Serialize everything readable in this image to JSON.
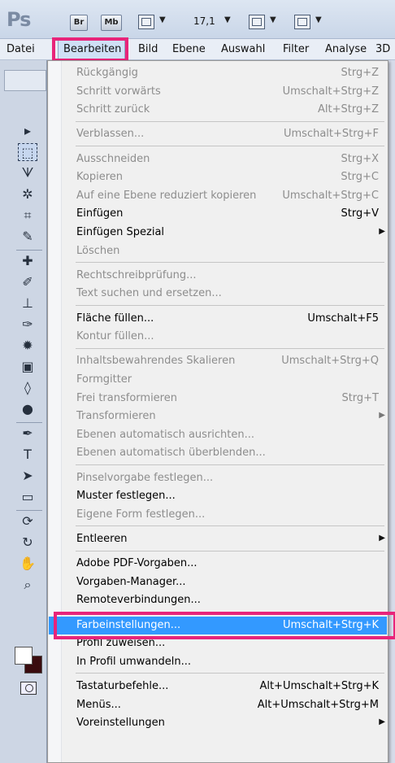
{
  "app": {
    "logo": "Ps",
    "bridge_label": "Br",
    "minibridge_label": "Mb",
    "zoom": "17,1"
  },
  "menubar": [
    "Datei",
    "Bearbeiten",
    "Bild",
    "Ebene",
    "Auswahl",
    "Filter",
    "Analyse",
    "3D"
  ],
  "highlight_color": "#e8247a",
  "selection_color": "#3399ff",
  "menu_groups": [
    [
      {
        "label": "Rückgängig",
        "shortcut": "Strg+Z",
        "enabled": false
      },
      {
        "label": "Schritt vorwärts",
        "shortcut": "Umschalt+Strg+Z",
        "enabled": false
      },
      {
        "label": "Schritt zurück",
        "shortcut": "Alt+Strg+Z",
        "enabled": false
      }
    ],
    [
      {
        "label": "Verblassen...",
        "shortcut": "Umschalt+Strg+F",
        "enabled": false
      }
    ],
    [
      {
        "label": "Ausschneiden",
        "shortcut": "Strg+X",
        "enabled": false
      },
      {
        "label": "Kopieren",
        "shortcut": "Strg+C",
        "enabled": false
      },
      {
        "label": "Auf eine Ebene reduziert kopieren",
        "shortcut": "Umschalt+Strg+C",
        "enabled": false
      },
      {
        "label": "Einfügen",
        "shortcut": "Strg+V",
        "enabled": true
      },
      {
        "label": "Einfügen Spezial",
        "shortcut": "",
        "enabled": true,
        "submenu": true
      },
      {
        "label": "Löschen",
        "shortcut": "",
        "enabled": false
      }
    ],
    [
      {
        "label": "Rechtschreibprüfung...",
        "shortcut": "",
        "enabled": false
      },
      {
        "label": "Text suchen und ersetzen...",
        "shortcut": "",
        "enabled": false
      }
    ],
    [
      {
        "label": "Fläche füllen...",
        "shortcut": "Umschalt+F5",
        "enabled": true
      },
      {
        "label": "Kontur füllen...",
        "shortcut": "",
        "enabled": false
      }
    ],
    [
      {
        "label": "Inhaltsbewahrendes Skalieren",
        "shortcut": "Umschalt+Strg+Q",
        "enabled": false
      },
      {
        "label": "Formgitter",
        "shortcut": "",
        "enabled": false
      },
      {
        "label": "Frei transformieren",
        "shortcut": "Strg+T",
        "enabled": false
      },
      {
        "label": "Transformieren",
        "shortcut": "",
        "enabled": false,
        "submenu": true
      },
      {
        "label": "Ebenen automatisch ausrichten...",
        "shortcut": "",
        "enabled": false
      },
      {
        "label": "Ebenen automatisch überblenden...",
        "shortcut": "",
        "enabled": false
      }
    ],
    [
      {
        "label": "Pinselvorgabe festlegen...",
        "shortcut": "",
        "enabled": false
      },
      {
        "label": "Muster festlegen...",
        "shortcut": "",
        "enabled": true
      },
      {
        "label": "Eigene Form festlegen...",
        "shortcut": "",
        "enabled": false
      }
    ],
    [
      {
        "label": "Entleeren",
        "shortcut": "",
        "enabled": true,
        "submenu": true
      }
    ],
    [
      {
        "label": "Adobe PDF-Vorgaben...",
        "shortcut": "",
        "enabled": true
      },
      {
        "label": "Vorgaben-Manager...",
        "shortcut": "",
        "enabled": true
      },
      {
        "label": "Remoteverbindungen...",
        "shortcut": "",
        "enabled": true
      }
    ],
    [
      {
        "label": "Farbeinstellungen...",
        "shortcut": "Umschalt+Strg+K",
        "enabled": true,
        "selected": true
      },
      {
        "label": "Profil zuweisen...",
        "shortcut": "",
        "enabled": true
      },
      {
        "label": "In Profil umwandeln...",
        "shortcut": "",
        "enabled": true
      }
    ],
    [
      {
        "label": "Tastaturbefehle...",
        "shortcut": "Alt+Umschalt+Strg+K",
        "enabled": true
      },
      {
        "label": "Menüs...",
        "shortcut": "Alt+Umschalt+Strg+M",
        "enabled": true
      },
      {
        "label": "Voreinstellungen",
        "shortcut": "",
        "enabled": true,
        "submenu": true
      }
    ]
  ],
  "tools": [
    {
      "icon": "move-tool-icon",
      "glyph": "▸"
    },
    {
      "icon": "marquee-tool-icon",
      "glyph": "⬚",
      "selected": true
    },
    {
      "icon": "lasso-tool-icon",
      "glyph": "ᗐ"
    },
    {
      "icon": "quick-selection-tool-icon",
      "glyph": "✲"
    },
    {
      "icon": "crop-tool-icon",
      "glyph": "⌗"
    },
    {
      "icon": "eyedropper-tool-icon",
      "glyph": "✎"
    },
    {
      "icon": "healing-brush-tool-icon",
      "glyph": "✚"
    },
    {
      "icon": "brush-tool-icon",
      "glyph": "✐"
    },
    {
      "icon": "clone-stamp-tool-icon",
      "glyph": "⊥"
    },
    {
      "icon": "history-brush-tool-icon",
      "glyph": "✑"
    },
    {
      "icon": "eraser-tool-icon",
      "glyph": "✹"
    },
    {
      "icon": "gradient-tool-icon",
      "glyph": "▣"
    },
    {
      "icon": "blur-tool-icon",
      "glyph": "◊"
    },
    {
      "icon": "dodge-tool-icon",
      "glyph": "●"
    },
    {
      "icon": "pen-tool-icon",
      "glyph": "✒"
    },
    {
      "icon": "type-tool-icon",
      "glyph": "T"
    },
    {
      "icon": "path-selection-tool-icon",
      "glyph": "➤"
    },
    {
      "icon": "shape-tool-icon",
      "glyph": "▭"
    },
    {
      "icon": "3d-rotate-tool-icon",
      "glyph": "⟳"
    },
    {
      "icon": "3d-orbit-tool-icon",
      "glyph": "↻"
    },
    {
      "icon": "hand-tool-icon",
      "glyph": "✋"
    },
    {
      "icon": "zoom-tool-icon",
      "glyph": "⌕"
    }
  ]
}
